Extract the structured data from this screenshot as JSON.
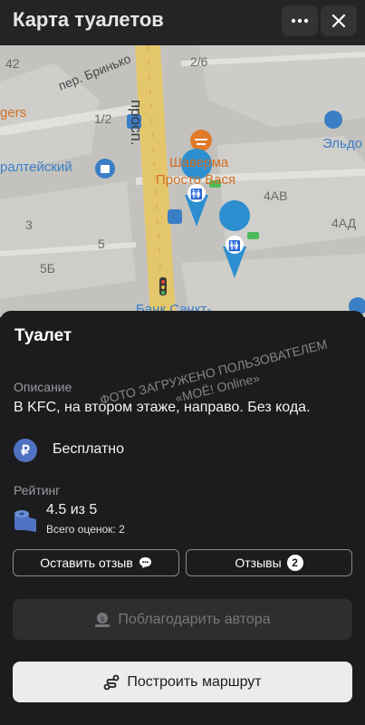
{
  "header": {
    "title": "Карта туалетов",
    "more_icon": "more-dots-icon",
    "close_icon": "close-icon"
  },
  "map": {
    "street_labels": [
      "пер. Бринько",
      "просп."
    ],
    "house_numbers": [
      "42",
      "2/6",
      "1/2",
      "4АВ",
      "4АД",
      "3",
      "5",
      "5Б"
    ],
    "poi_labels": {
      "left_partial_1": "gers",
      "left_partial_2": "ралтейский",
      "right_partial": "Эльдо",
      "shawarma": [
        "Шаверма",
        "Просто Вася"
      ],
      "bank": "Банк Санкт-"
    }
  },
  "sheet": {
    "title": "Туалет",
    "description_label": "Описание",
    "description_text": "В KFC, на втором этаже, направо. Без кода.",
    "price_symbol": "₽",
    "price_text": "Бесплатно",
    "rating_label": "Рейтинг",
    "rating_value": "4.5 из 5",
    "rating_count": "Всего оценок: 2",
    "leave_review_label": "Оставить отзыв",
    "reviews_label": "Отзывы",
    "reviews_count": "2",
    "thank_author_label": "Поблагодарить автора",
    "route_label": "Построить маршрут"
  },
  "watermark": {
    "line1": "ФОТО ЗАГРУЖЕНО ПОЛЬЗОВАТЕЛЕМ",
    "line2": "«МОЁ! Online»"
  },
  "colors": {
    "header_bg": "#242426",
    "sheet_bg": "#1c1c1e",
    "marker": "#2d8fcf",
    "route_road": "#e5c76b",
    "poi_orange": "#e07b2a",
    "poi_blue": "#3a7ec6",
    "price_icon": "#4f72c2"
  }
}
